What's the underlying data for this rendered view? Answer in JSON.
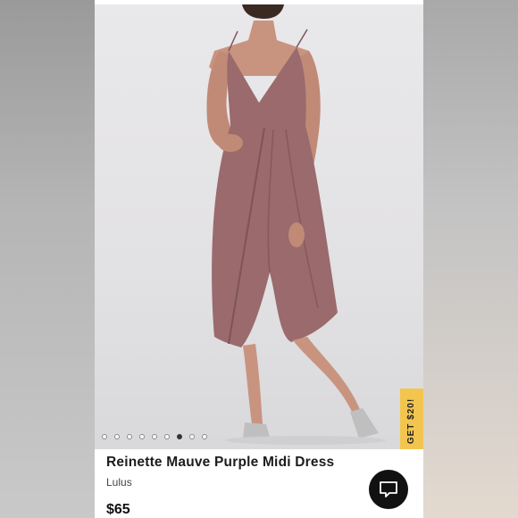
{
  "product": {
    "title": "Reinette Mauve Purple Midi Dress",
    "brand": "Lulus",
    "price": "$65"
  },
  "promo": {
    "label": "GET $20!"
  },
  "carousel": {
    "total": 9,
    "active_index": 6
  },
  "icons": {
    "chat": "chat-bubble-icon"
  },
  "colors": {
    "dress": "#9a6a6c",
    "promo": "#f2c64e",
    "chat": "#111111"
  }
}
